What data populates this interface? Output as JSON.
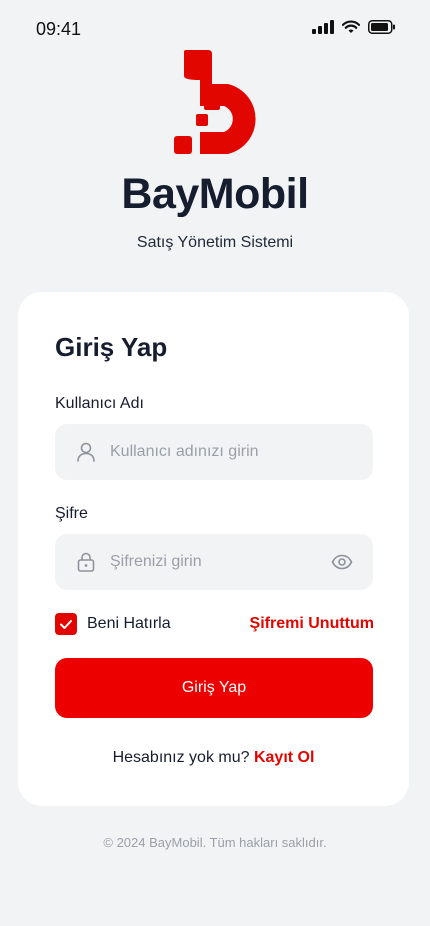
{
  "status_bar": {
    "time": "09:41"
  },
  "brand": {
    "name": "BayMobil",
    "subtitle": "Satış Yönetim Sistemi",
    "accent": "#e10600"
  },
  "login_card": {
    "title": "Giriş Yap",
    "username": {
      "label": "Kullanıcı Adı",
      "placeholder": "Kullanıcı adınızı girin",
      "value": ""
    },
    "password": {
      "label": "Şifre",
      "placeholder": "Şifrenizi girin",
      "value": ""
    },
    "remember_me": {
      "label": "Beni Hatırla",
      "checked": true
    },
    "forgot_password": "Şifremi Unuttum",
    "submit_label": "Giriş Yap",
    "register_prompt": "Hesabınız yok mu?",
    "register_link": "Kayıt Ol"
  },
  "footer": {
    "copyright": "© 2024 BayMobil. Tüm hakları saklıdır."
  },
  "icons": [
    "signal-icon",
    "wifi-icon",
    "battery-icon",
    "user-icon",
    "lock-icon",
    "eye-icon",
    "check-icon"
  ]
}
